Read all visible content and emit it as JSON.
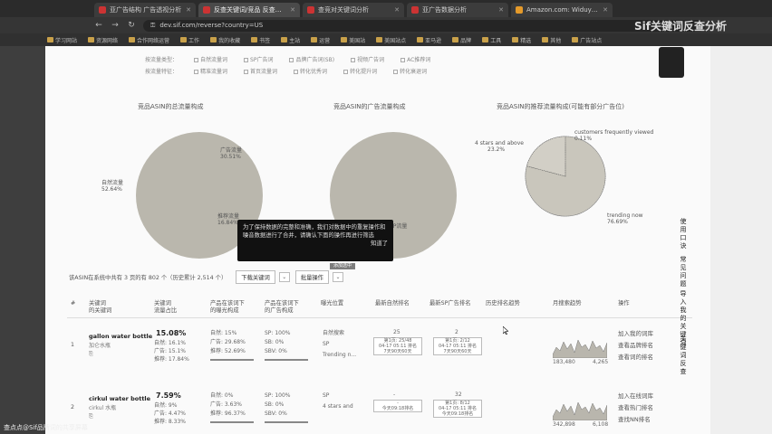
{
  "browser": {
    "tabs": [
      {
        "title": "亚广告结构 广告透视分析"
      },
      {
        "title": "反查关键词/竞品 反查关键词分析"
      },
      {
        "title": "查竞对关键词分析"
      },
      {
        "title": "亚广告数据分析"
      },
      {
        "title": "Amazon.com: Widuyi One..."
      }
    ],
    "url": "dev.sif.com/reverse?country=US",
    "bookmarks": [
      "学习网站",
      "资源网络",
      "合作网络运营",
      "工作",
      "我的收藏",
      "书签",
      "主站",
      "运营",
      "美国站",
      "美国站点",
      "亚马逊",
      "品牌",
      "工具",
      "精选",
      "其他",
      "广告站点"
    ]
  },
  "watermark": "Sif关键词反查分析",
  "filters": {
    "row1_label": "按流量类型：",
    "row1": [
      "自然流量词",
      "SP广告词",
      "品牌广告词(SB)",
      "视频广告词",
      "AC推荐词"
    ],
    "row2_label": "按流量特征：",
    "row2": [
      "精准流量词",
      "首页流量词",
      "转化优秀词",
      "转化提升词",
      "转化衰退词"
    ]
  },
  "pies": {
    "p1_title": "竞品ASIN的总流量构成",
    "p1_labels": {
      "ad": "广告流量",
      "ad_pct": "30.51%",
      "natural": "自然流量",
      "natural_pct": "52.64%",
      "rec": "推荐流量",
      "rec_pct": "16.84%"
    },
    "p2_title": "竞品ASIN的广告流量构成",
    "p2_labels": {
      "sp": "SP流量"
    },
    "p3_title": "竞品ASIN的推荐流量构成(可能有部分广告位)",
    "p3_labels": {
      "a": "4 stars and above",
      "a_pct": "23.2%",
      "b": "customers frequently viewed",
      "b_pct": "0.11%",
      "c": "trending now",
      "c_pct": "76.69%"
    }
  },
  "tooltip": {
    "text": "为了保持数据的完整和准确，我们对数据中的重复操作和噪音数据进行了合并，请确认下面的操作再进行筛选",
    "ok": "知道了"
  },
  "controls": {
    "summary": "该ASIN在系统中共有 3 页的有 802 个（历史累计 2,514 个）",
    "download": "下载关键词",
    "batch": "批量操作",
    "add_tag": "添加选中"
  },
  "table": {
    "headers": [
      "#",
      "关键词\n的关键词",
      "关键词\n流量占比",
      "产品在该词下\n的曝光构成",
      "产品在该词下\n的广告构成",
      "曝光位置",
      "最新自然排名",
      "最新SP广告排名",
      "历史排名趋势",
      "月搜索趋势",
      "操作"
    ],
    "rows": [
      {
        "no": "1",
        "keyword": "gallon water bottle",
        "sub": "加仑水瓶",
        "pct": "15.08%",
        "split": [
          "自然: 16.1%",
          "广告: 15.1%",
          "推荐: 17.84%"
        ],
        "exposure": [
          "自然: 15%",
          "广告: 29.68%",
          "推荐: 52.69%"
        ],
        "ads": [
          "SP: 100%",
          "SB: 0%",
          "SBV: 0%"
        ],
        "position": [
          "自然搜索",
          "SP",
          "Trending n..."
        ],
        "natural_rank": "25",
        "natural_box": [
          "第1页: 25/48",
          "04-17 05:11 排名",
          "7天90天60天"
        ],
        "sp_rank": "2",
        "sp_box": [
          "第1页: 2/12",
          "04-17 05:11 排名",
          "7天90天60天"
        ],
        "search_low": "183,480",
        "search_high": "4,265",
        "ops": [
          "加入我的词库",
          "查看品牌排名",
          "查看词的排名"
        ]
      },
      {
        "no": "2",
        "keyword": "cirkul water bottle",
        "sub": "cirkul 水瓶",
        "pct": "7.59%",
        "split": [
          "自然: 9%",
          "广告: 4.47%",
          "推荐: 8.33%"
        ],
        "exposure": [
          "自然: 0%",
          "广告: 3.63%",
          "推荐: 96.37%"
        ],
        "ads": [
          "SP: 100%",
          "SB: 0%",
          "SBV: 0%"
        ],
        "position": [
          "SP",
          "4 stars and"
        ],
        "natural_rank": "-",
        "natural_box": [
          "-",
          "",
          "今天09:18排名"
        ],
        "sp_rank": "32",
        "sp_box": [
          "第1页: 8/12",
          "04-17 05:11 排名",
          "今天09:18排名"
        ],
        "search_low": "342,898",
        "search_high": "6,108",
        "ops": [
          "加入在线词库",
          "查看热门排名",
          "查找NN排名"
        ]
      }
    ]
  },
  "sidebar_right": [
    "使用口诀",
    "常见问题",
    "导入我的关键词",
    "关键词反查"
  ],
  "caption": "查点点@Sif品牌词的共享屏幕"
}
